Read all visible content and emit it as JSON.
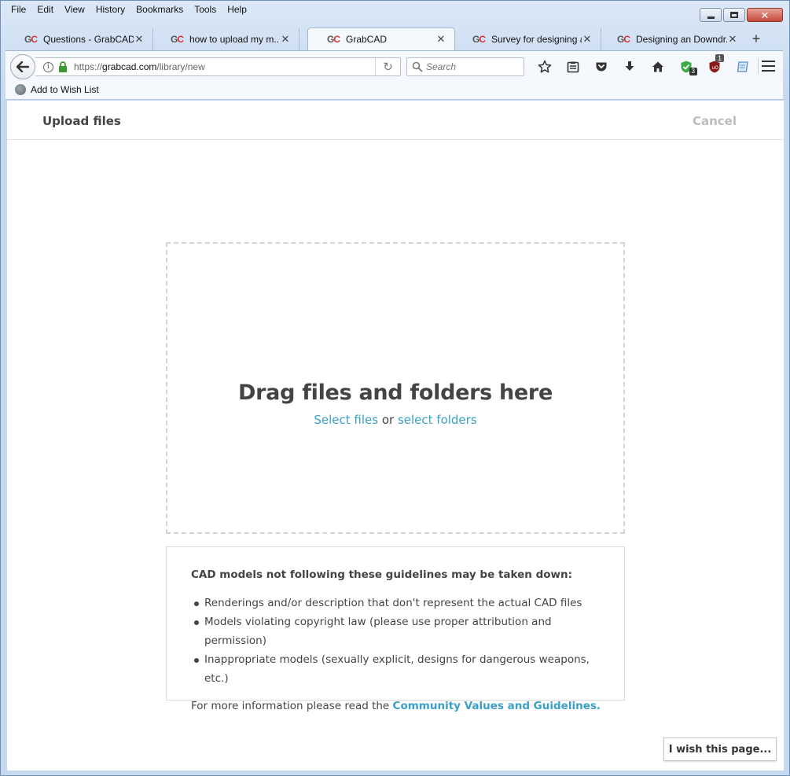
{
  "menubar": {
    "items": [
      {
        "label": "File",
        "key": "F"
      },
      {
        "label": "Edit",
        "key": "E"
      },
      {
        "label": "View",
        "key": "V"
      },
      {
        "label": "History",
        "key": "s"
      },
      {
        "label": "Bookmarks",
        "key": "B"
      },
      {
        "label": "Tools",
        "key": "T"
      },
      {
        "label": "Help",
        "key": "H"
      }
    ]
  },
  "tabs": [
    {
      "title": "Questions - GrabCAD",
      "favicon": "GC"
    },
    {
      "title": "how to upload my m...",
      "favicon": "GC"
    },
    {
      "title": "GrabCAD",
      "favicon": "GC",
      "active": true
    },
    {
      "title": "Survey for designing a...",
      "favicon": "GC"
    },
    {
      "title": "Designing an Downdr...",
      "favicon": "GC"
    }
  ],
  "navbar": {
    "url_prefix": "https://",
    "url_host": "grabcad.com",
    "url_path": "/library/new",
    "search_placeholder": "Search",
    "shield_badge": "3",
    "ublock_badge": "1"
  },
  "bookmarks": {
    "items": [
      {
        "label": "Add to Wish List"
      }
    ]
  },
  "page": {
    "title": "Upload files",
    "cancel": "Cancel",
    "dropzone": {
      "heading": "Drag files and folders here",
      "select_files": "Select files",
      "or": "or",
      "select_folders": "select folders"
    },
    "guidelines": {
      "heading": "CAD models not following these guidelines may be taken down:",
      "items": [
        "Renderings and/or description that don't represent the actual CAD files",
        "Models violating copyright law (please use proper attribution and permission)",
        "Inappropriate models (sexually explicit, designs for dangerous weapons, etc.)"
      ],
      "more_prefix": "For more information please read the",
      "more_link": "Community Values and Guidelines."
    },
    "feedback_button": "I wish this page..."
  },
  "colors": {
    "link": "#3aa0c7",
    "heading": "#444444",
    "cancel": "#bdbdbd",
    "favicon": "#dd3333"
  }
}
